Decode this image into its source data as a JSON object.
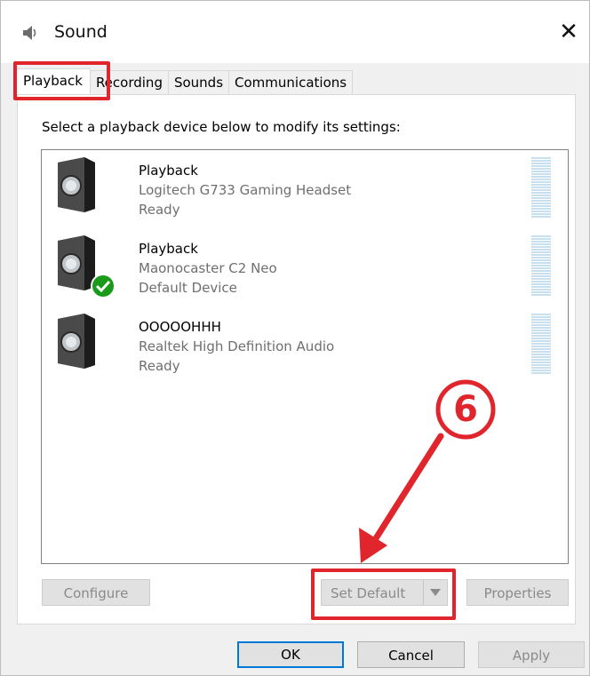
{
  "window": {
    "title": "Sound",
    "close_glyph": "✕"
  },
  "tabs": [
    {
      "label": "Playback",
      "active": true
    },
    {
      "label": "Recording",
      "active": false
    },
    {
      "label": "Sounds",
      "active": false
    },
    {
      "label": "Communications",
      "active": false
    }
  ],
  "instruction": "Select a playback device below to modify its settings:",
  "devices": [
    {
      "name": "Playback",
      "description": "Logitech G733 Gaming Headset",
      "status": "Ready",
      "icon": "speaker-icon",
      "default": false
    },
    {
      "name": "Playback",
      "description": "Maonocaster C2 Neo",
      "status": "Default Device",
      "icon": "speaker-icon",
      "default": true
    },
    {
      "name": "OOOOOHHH",
      "description": "Realtek High Definition Audio",
      "status": "Ready",
      "icon": "speaker-icon",
      "default": false
    }
  ],
  "buttons": {
    "configure": "Configure",
    "set_default": "Set Default",
    "properties": "Properties",
    "ok": "OK",
    "cancel": "Cancel",
    "apply": "Apply"
  },
  "annotation": {
    "step_number": "6",
    "color": "#e0262c"
  },
  "colors": {
    "accent": "#0078d7",
    "check_green": "#1a9a1a",
    "meter": "#c8dff0"
  }
}
